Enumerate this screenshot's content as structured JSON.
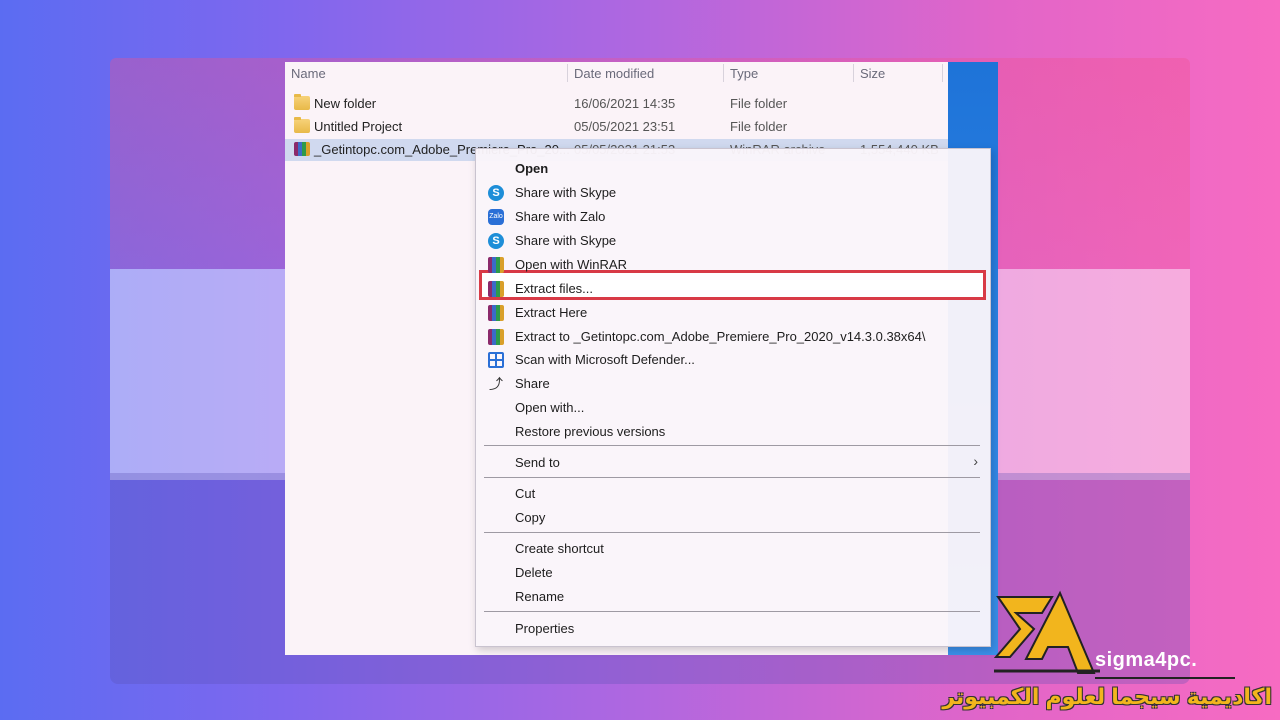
{
  "explorer": {
    "columns": {
      "name": "Name",
      "date": "Date modified",
      "type": "Type",
      "size": "Size"
    },
    "files": [
      {
        "name": "New folder",
        "date": "16/06/2021 14:35",
        "type": "File folder",
        "size": "",
        "icon": "folder-icon"
      },
      {
        "name": "Untitled Project",
        "date": "05/05/2021 23:51",
        "type": "File folder",
        "size": "",
        "icon": "folder-icon"
      },
      {
        "name": "_Getintopc.com_Adobe_Premiere_Pro_20...",
        "date": "05/05/2021 21:53",
        "type": "WinRAR archive",
        "size": "1,554,440 KB",
        "icon": "winrar-icon"
      }
    ]
  },
  "context_menu": {
    "items": [
      {
        "label": "Open",
        "bold": true
      },
      {
        "label": "Share with Skype",
        "icon": "skype-icon"
      },
      {
        "label": "Share with Zalo",
        "icon": "zalo-icon"
      },
      {
        "label": "Share with Skype",
        "icon": "skype-icon"
      },
      {
        "label": "Open with WinRAR",
        "icon": "winrar-icon"
      },
      {
        "label": "Extract files...",
        "icon": "winrar-icon",
        "highlighted": true
      },
      {
        "label": "Extract Here",
        "icon": "winrar-icon"
      },
      {
        "label": "Extract to _Getintopc.com_Adobe_Premiere_Pro_2020_v14.3.0.38x64\\",
        "icon": "winrar-icon"
      },
      {
        "label": "Scan with Microsoft Defender...",
        "icon": "defender-icon"
      },
      {
        "label": "Share",
        "icon": "share-icon"
      },
      {
        "label": "Open with..."
      },
      {
        "label": "Restore previous versions"
      },
      {
        "label": "Send to",
        "submenu": true
      },
      {
        "label": "Cut"
      },
      {
        "label": "Copy"
      },
      {
        "label": "Create shortcut"
      },
      {
        "label": "Delete"
      },
      {
        "label": "Rename"
      },
      {
        "label": "Properties"
      }
    ]
  },
  "branding": {
    "logo_text": "sigma4pc.",
    "arabic_text": "اكاديمية سيجما لعلوم الكمبيوتر",
    "highlight_color": "#d83a46",
    "logo_color": "#f2b51d"
  }
}
